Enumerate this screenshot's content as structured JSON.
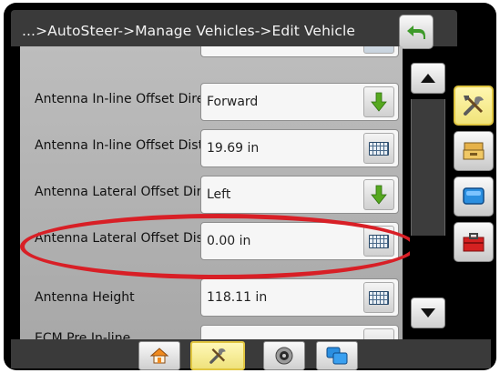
{
  "title": "...>AutoSteer->Manage Vehicles->Edit Vehicle",
  "rows": [
    {
      "label": "Antenna In-line Offset Direction",
      "value": "Forward",
      "control": "dropdown-arrow"
    },
    {
      "label": "Antenna In-line Offset Distance",
      "value": "19.69 in",
      "control": "keyboard-icon"
    },
    {
      "label": "Antenna Lateral Offset Direction",
      "value": "Left",
      "control": "dropdown-arrow"
    },
    {
      "label": "Antenna Lateral Offset Distance",
      "value": "0.00 in",
      "control": "keyboard-icon"
    },
    {
      "label": "Antenna Height",
      "value": "118.11 in",
      "control": "keyboard-icon"
    },
    {
      "label": "ECM Pre In-line",
      "value": "",
      "control": "dropdown-arrow"
    }
  ],
  "colors": {
    "highlight": "#d81f26",
    "active_tab": "#f0e37a",
    "accent_green": "#4f9d1d",
    "titlebar": "#3a3a3a"
  },
  "side_tabs": [
    "tools-icon",
    "storage-icon",
    "display-icon",
    "toolbox-icon"
  ],
  "bottom_tabs": [
    "home-icon",
    "tools-icon",
    "camera-icon",
    "display-icon"
  ]
}
